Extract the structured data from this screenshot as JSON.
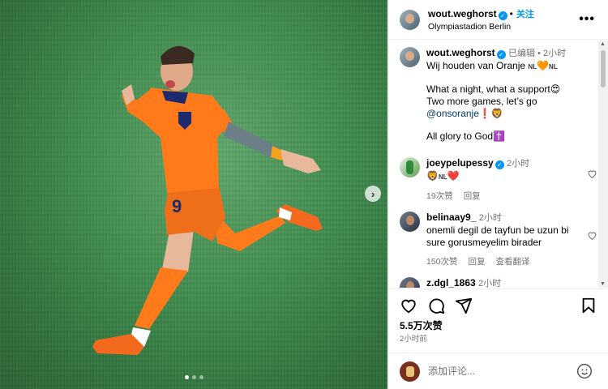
{
  "post": {
    "username": "wout.weghorst",
    "follow_label": "关注",
    "location": "Olympiastadion Berlin",
    "more_label": "•••"
  },
  "caption": {
    "username": "wout.weghorst",
    "edited": "已编辑",
    "time": "2小时",
    "line1": "Wij houden van Oranje",
    "flag1": "NL",
    "heart1": "🧡",
    "flag2": "NL",
    "line2": "What a night, what a support",
    "emoji2": "😍",
    "line3": "Two more games, let’s go",
    "mention": "@onsoranje",
    "emoji3": "❗🦁",
    "line4": "All glory to God",
    "emoji4": "✝️"
  },
  "comments": [
    {
      "username": "joeypelupessy",
      "verified": true,
      "time": "2小时",
      "text_emoji": "🦁",
      "text_flag": "NL",
      "text_heart": "❤️",
      "likes": "19次赞",
      "reply": "回复"
    },
    {
      "username": "belinaay9_",
      "verified": false,
      "time": "2小时",
      "text": "onemli degil de tayfun be uzun bi sure gorusmeyelim birader",
      "likes": "150次赞",
      "reply": "回复",
      "translate": "查看翻译"
    },
    {
      "username": "z.dgl_1863",
      "time": "2小时"
    }
  ],
  "stats": {
    "likes": "5.5万次赞",
    "posted": "2小时前"
  },
  "add_comment": {
    "placeholder": "添加评论..."
  },
  "carousel": {
    "next_label": "›"
  },
  "icons": [
    "heart-icon",
    "comment-icon",
    "share-icon",
    "bookmark-icon",
    "emoji-icon",
    "more-icon",
    "verified-icon"
  ]
}
